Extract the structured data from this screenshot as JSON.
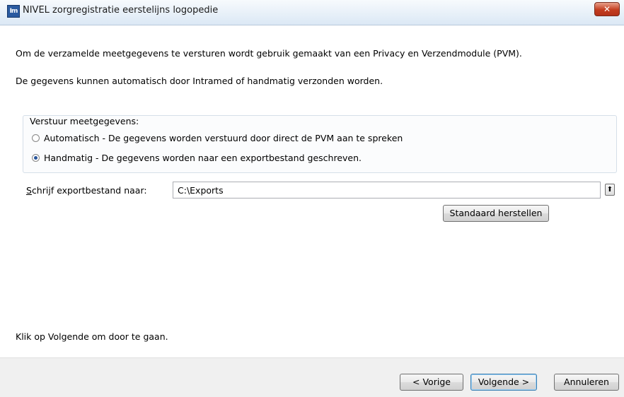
{
  "window": {
    "title": "NIVEL zorgregistratie eerstelijns logopedie",
    "icon_text": "Im",
    "close_glyph": "✕"
  },
  "intro": {
    "line1": "Om de verzamelde meetgegevens te versturen  wordt gebruik gemaakt van een Privacy en Verzendmodule (PVM).",
    "line2": "De gegevens kunnen automatisch door Intramed of handmatig verzonden worden."
  },
  "send_group": {
    "label": "Verstuur meetgegevens:",
    "options": [
      {
        "label": "Automatisch - De gegevens worden verstuurd door direct de PVM aan te spreken",
        "selected": false
      },
      {
        "label": "Handmatig - De gegevens worden naar een exportbestand geschreven.",
        "selected": true
      }
    ]
  },
  "export": {
    "label_access_key": "S",
    "label_rest": "chrijf exportbestand naar:",
    "path_value": "C:\\Exports",
    "browse_glyph": "⬆",
    "restore_label": "Standaard herstellen"
  },
  "hint": "Klik op Volgende om door te gaan.",
  "footer": {
    "back_label": "< Vorige",
    "next_label": "Volgende >",
    "cancel_label": "Annuleren"
  }
}
